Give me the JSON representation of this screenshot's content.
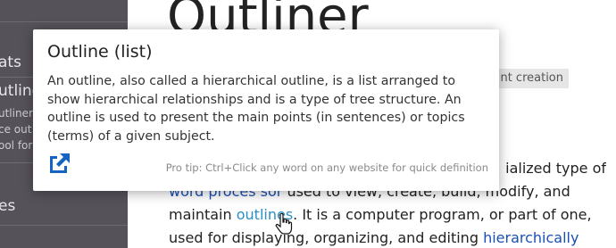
{
  "sidebar": {
    "items": [
      {
        "text": "ats"
      },
      {
        "text": "utliner"
      },
      {
        "text": "utliners"
      },
      {
        "text": "ce out"
      },
      {
        "text": "ool for"
      },
      {
        "text": "es"
      }
    ]
  },
  "main": {
    "title": "Outliner",
    "tag": "nt creation",
    "lines": [
      {
        "text": "ialized type of"
      },
      {
        "parts": [
          "word proces sor",
          " used to view, create, build, modify, and"
        ]
      },
      {
        "parts": [
          "maintain ",
          "outlines",
          ". It is a computer program, or part of one,"
        ]
      },
      {
        "parts": [
          "used for displaying, organizing, and editing ",
          "hierarchically"
        ]
      }
    ]
  },
  "popup": {
    "title": "Outline (list)",
    "body": "An outline, also called a hierarchical outline, is a list arranged to show hierarchical relationships and is a type of tree structure. An outline is used to present the main points (in sentences) or topics (terms) of a given subject.",
    "tip": "Pro tip: Ctrl+Click any word on any website for quick definition",
    "link_icon": "external-link-icon"
  },
  "colors": {
    "sidebar_bg": "#56525a",
    "link_blue": "#1a4fb5",
    "link_cyan": "#2a8fc7",
    "icon_blue": "#1565c0"
  }
}
